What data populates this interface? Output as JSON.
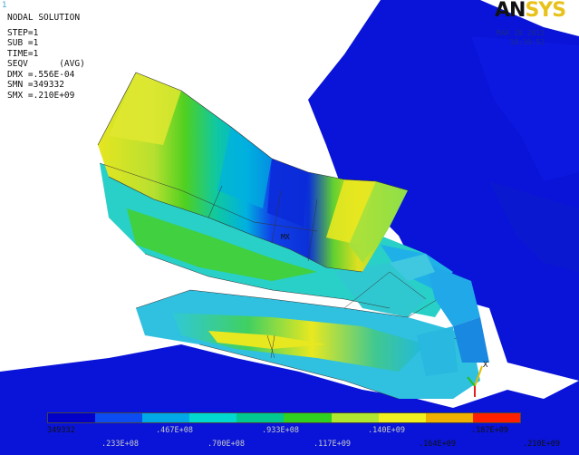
{
  "window_number": "1",
  "info": {
    "title": "NODAL SOLUTION",
    "step": "STEP=1",
    "sub": "SUB =1",
    "time": "TIME=1",
    "seqv": "SEQV      (AVG)",
    "dmx": "DMX =.556E-04",
    "smn": "SMN =349332",
    "smx": "SMX =.210E+09"
  },
  "logo": {
    "part1": "AN",
    "part2": "SYS"
  },
  "datestamp": {
    "date": "MAR 28 2012",
    "time": "18:36:52"
  },
  "max_marker": "MX",
  "triad": {
    "x_label": "X"
  },
  "legend": {
    "colors": [
      "#0000c8",
      "#0b4df0",
      "#00a8e8",
      "#00d8d0",
      "#00c890",
      "#30d020",
      "#b0e830",
      "#f0f020",
      "#f0b000",
      "#ff2000"
    ],
    "labels_top": [
      "349332",
      ".187E+09"
    ],
    "labels_bottom": [
      ".164E+09",
      ".210E+09"
    ],
    "labels_faded": [
      ".467E+08",
      ".933E+08",
      ".140E+09",
      ".233E+08",
      ".700E+08",
      ".117E+09"
    ]
  }
}
